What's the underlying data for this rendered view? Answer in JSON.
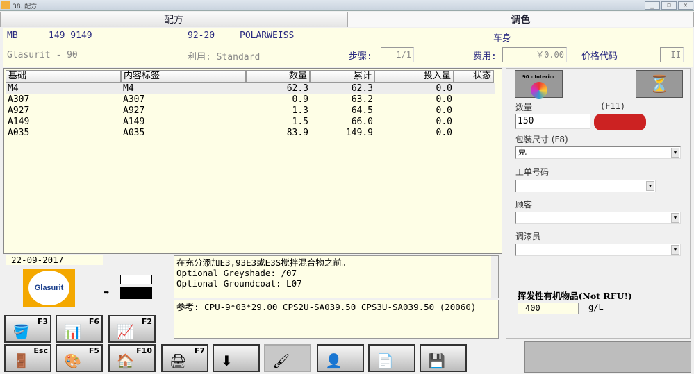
{
  "window": {
    "title": "38. 配方"
  },
  "tabs": [
    {
      "label": "配方"
    },
    {
      "label": "调色"
    }
  ],
  "info": {
    "mb": "MB",
    "code": "149 9149",
    "color_code": "92-20",
    "color_name": "POLARWEISS",
    "part": "车身",
    "brand": "Glasurit - 90",
    "usage": "利用: Standard",
    "step_label": "步骤:",
    "step_value": "1/1",
    "cost_label": "费用:",
    "cost_value": "￥0.00",
    "price_code_label": "价格代码",
    "price_code_value": "II"
  },
  "table": {
    "headers": [
      "基础",
      "内容标签",
      "数量",
      "累计",
      "投入量",
      "状态"
    ],
    "rows": [
      [
        "M4",
        "M4",
        "62.3",
        "62.3",
        "0.0",
        ""
      ],
      [
        "A307",
        "A307",
        "0.9",
        "63.2",
        "0.0",
        ""
      ],
      [
        "A927",
        "A927",
        "1.3",
        "64.5",
        "0.0",
        ""
      ],
      [
        "A149",
        "A149",
        "1.5",
        "66.0",
        "0.0",
        ""
      ],
      [
        "A035",
        "A035",
        "83.9",
        "149.9",
        "0.0",
        ""
      ]
    ]
  },
  "right": {
    "interior_label": "90 - Interior",
    "qty_label": "数量",
    "qty_value": "150",
    "f11": "(F11)",
    "pack_label": "包装尺寸 (F8)",
    "pack_value": "克",
    "order_label": "工单号码",
    "customer_label": "顾客",
    "mixer_label": "调漆员",
    "voc_label": "挥发性有机物品(Not RFU!)",
    "voc_value": "400",
    "voc_unit": "g/L"
  },
  "date": "22-09-2017",
  "logo": "Glasurit",
  "notes": [
    "在充分添加E3,93E3或E3S搅拌混合物之前。",
    "Optional Greyshade: /07",
    "Optional Groundcoat: L07"
  ],
  "reference": "参考: CPU-9*03*29.00 CPS2U-SA039.50 CPS3U-SA039.50 (20060)",
  "buttons_row1": [
    {
      "key": "F3"
    },
    {
      "key": "F6"
    },
    {
      "key": "F2"
    }
  ],
  "buttons_row2": [
    {
      "key": "Esc"
    },
    {
      "key": "F5"
    },
    {
      "key": "F10"
    },
    {
      "key": "F7"
    },
    {
      "key": ""
    },
    {
      "key": ""
    },
    {
      "key": ""
    },
    {
      "key": ""
    },
    {
      "key": ""
    }
  ]
}
